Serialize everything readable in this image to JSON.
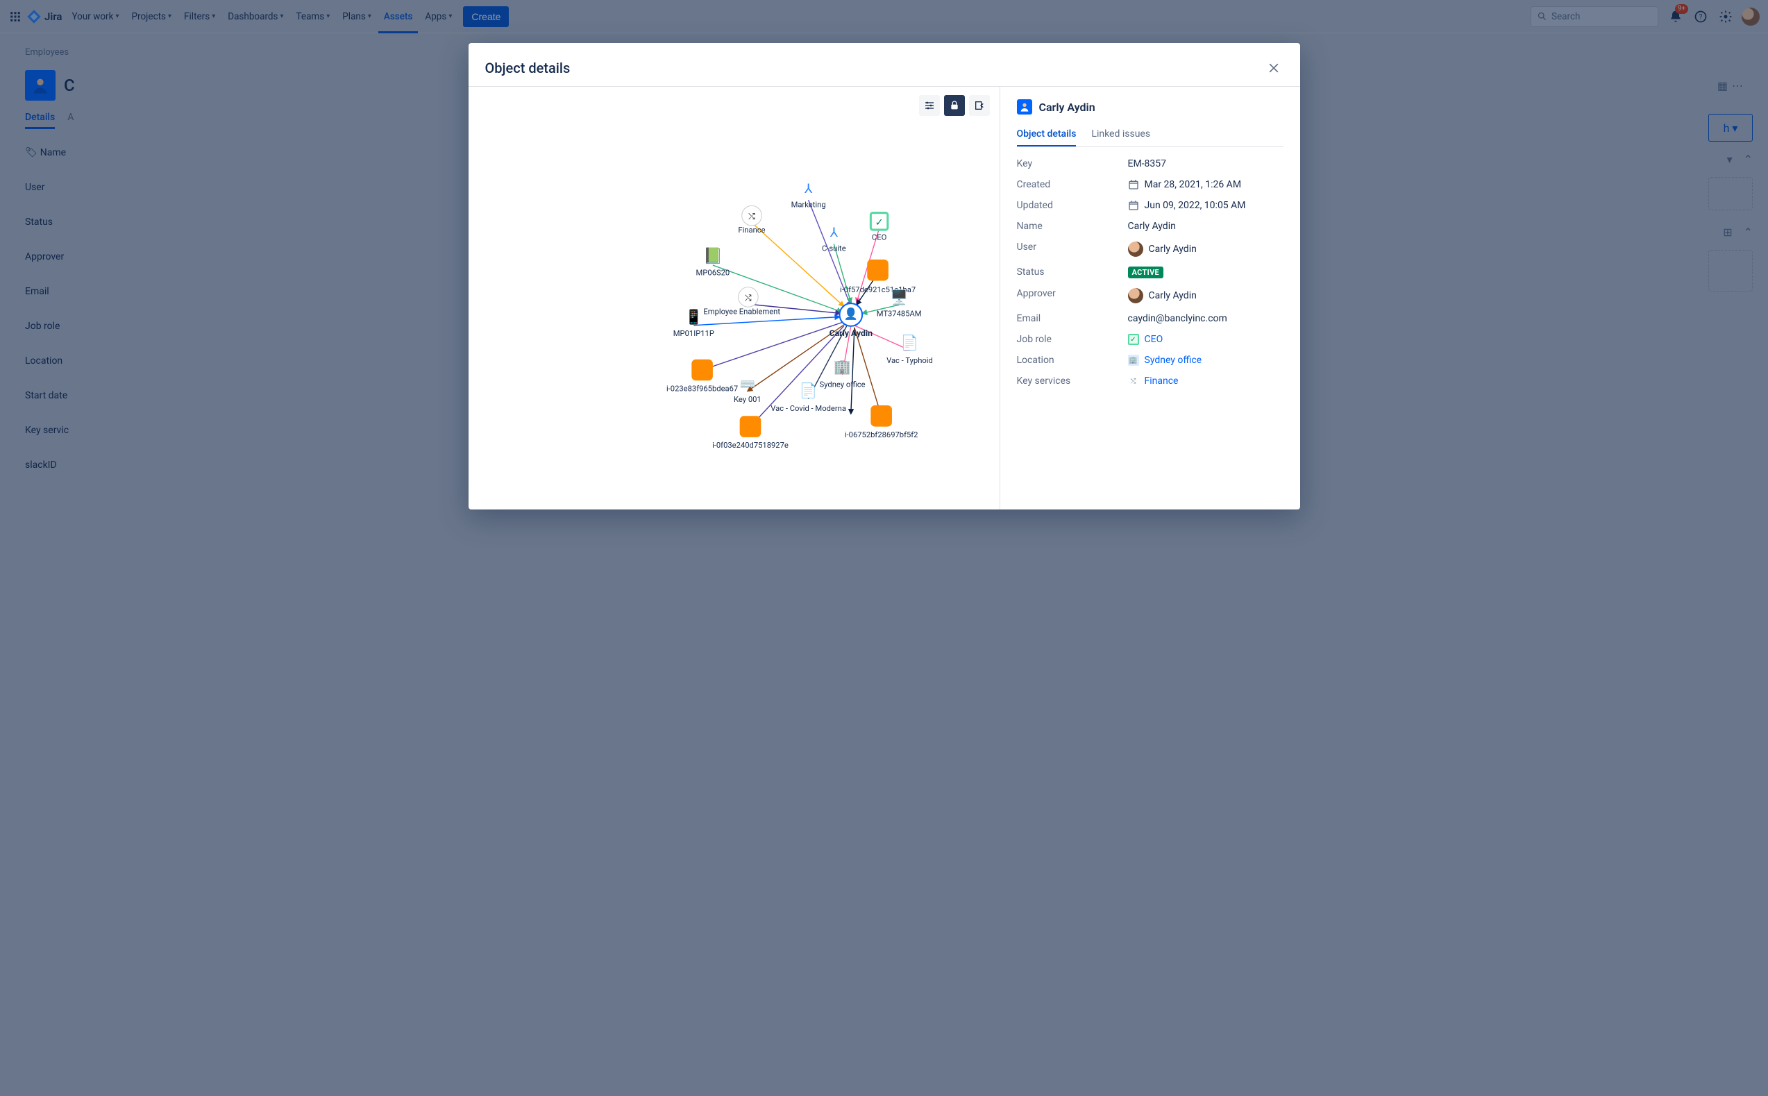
{
  "nav": {
    "product": "Jira",
    "items": [
      {
        "label": "Your work",
        "dropdown": true
      },
      {
        "label": "Projects",
        "dropdown": true
      },
      {
        "label": "Filters",
        "dropdown": true
      },
      {
        "label": "Dashboards",
        "dropdown": true
      },
      {
        "label": "Teams",
        "dropdown": true
      },
      {
        "label": "Plans",
        "dropdown": true
      },
      {
        "label": "Assets",
        "dropdown": false,
        "active": true
      },
      {
        "label": "Apps",
        "dropdown": true
      }
    ],
    "create": "Create",
    "search_placeholder": "Search",
    "notif_badge": "9+"
  },
  "page_behind": {
    "breadcrumb": "Employees",
    "title": "C",
    "tabs": [
      "Details",
      "A"
    ],
    "labels": [
      "Name",
      "User",
      "Status",
      "Approver",
      "Email",
      "Job role",
      "Location",
      "Start date",
      "Key servic",
      "slackID"
    ]
  },
  "modal": {
    "title": "Object details",
    "graph": {
      "center": "Carly Aydin",
      "nodes": [
        "Marketing",
        "Finance",
        "CEO",
        "C-suite",
        "i-0f57de921c51e1ba7",
        "MP06S20",
        "Employee Enablement",
        "MP01IP11P",
        "MT37485AM",
        "i-023e83f965bdea67",
        "Key 001",
        "Vac - Typhoid",
        "Sydney office",
        "Vac - Covid - Moderna",
        "i-0f03e240d7518927e",
        "i-06752bf28697bf5f2"
      ]
    },
    "detail": {
      "title": "Carly Aydin",
      "tabs": [
        "Object details",
        "Linked issues"
      ],
      "fields": {
        "key_label": "Key",
        "key": "EM-8357",
        "created_label": "Created",
        "created": "Mar 28, 2021, 1:26 AM",
        "updated_label": "Updated",
        "updated": "Jun 09, 2022, 10:05 AM",
        "name_label": "Name",
        "name": "Carly Aydin",
        "user_label": "User",
        "user": "Carly Aydin",
        "status_label": "Status",
        "status": "ACTIVE",
        "approver_label": "Approver",
        "approver": "Carly Aydin",
        "email_label": "Email",
        "email": "caydin@banclyinc.com",
        "jobrole_label": "Job role",
        "jobrole": "CEO",
        "location_label": "Location",
        "location": "Sydney office",
        "keyservices_label": "Key services",
        "keyservices": "Finance"
      }
    }
  }
}
